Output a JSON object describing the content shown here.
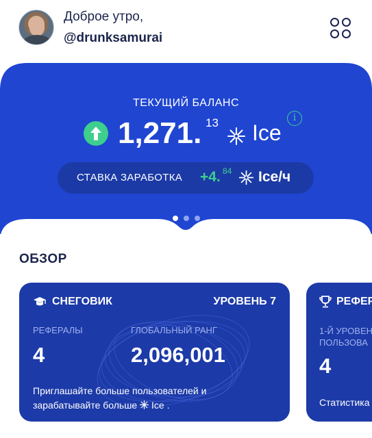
{
  "header": {
    "greeting": "Доброе утро,",
    "username": "@drunksamurai",
    "avatar_icon": "user-photo",
    "menu_icon": "four-dots-grid-icon"
  },
  "balance": {
    "label": "ТЕКУЩИЙ БАЛАНС",
    "integer": "1,271.",
    "fraction": "13",
    "unit": "Ice",
    "trend_icon": "arrow-up-icon",
    "info_icon": "info-icon",
    "rate": {
      "label": "СТАВКА ЗАРАБОТКА",
      "integer": "+4.",
      "fraction": "84",
      "unit": "Ice/ч"
    },
    "pager": {
      "count": 3,
      "active": 0
    }
  },
  "overview": {
    "title": "ОБЗОР",
    "cards": [
      {
        "title": "СНЕГОВИК",
        "level": "УРОВЕНЬ 7",
        "icon": "graduation-cap-icon",
        "stats": [
          {
            "label": "РЕФЕРАЛЫ",
            "value": "4"
          },
          {
            "label": "ГЛОБАЛЬНЫЙ РАНГ",
            "value": "2,096,001"
          }
        ],
        "footer_line1": "Приглашайте больше пользователей и",
        "footer_line2_prefix": "зарабатывайте больше",
        "footer_line2_suffix": "Ice ."
      },
      {
        "title": "РЕФЕР",
        "icon": "trophy-icon",
        "label_line1": "1-Й УРОВЕН",
        "label_line2": "ПОЛЬЗОВА",
        "value": "4",
        "footer": "Статистика"
      }
    ]
  },
  "colors": {
    "primary_blue": "#1f45d1",
    "card_blue": "#1c3aa8",
    "accent_green": "#3ecf8e",
    "text_dark": "#1b254b"
  }
}
